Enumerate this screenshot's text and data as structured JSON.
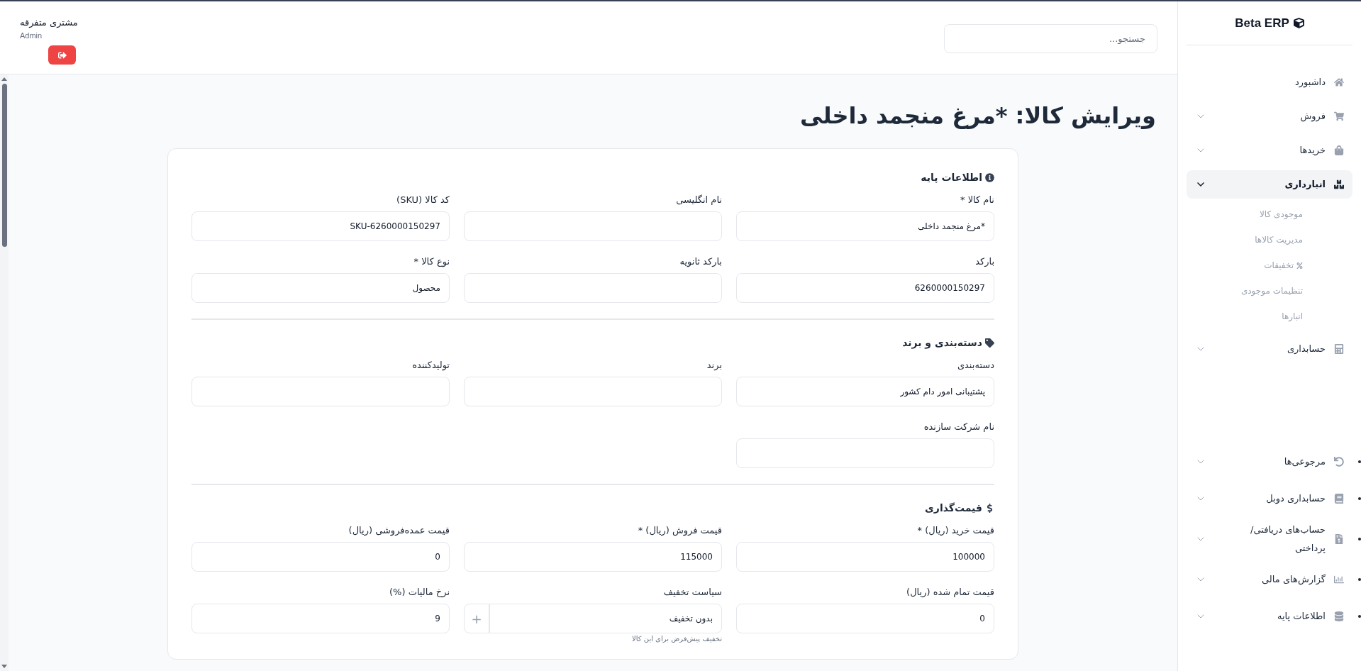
{
  "sidebar": {
    "brand": "Beta ERP",
    "items": [
      {
        "label": "داشبورد",
        "kind": "link",
        "selected": false
      },
      {
        "label": "فروش",
        "kind": "group",
        "selected": false,
        "expanded": false
      },
      {
        "label": "خریدها",
        "kind": "group",
        "selected": false,
        "expanded": false
      },
      {
        "label": "انبارداری",
        "kind": "group",
        "selected": true,
        "expanded": true,
        "children": [
          {
            "label": "موجودی کالا",
            "kind": "plain"
          },
          {
            "label": "مدیریت کالاها",
            "kind": "plain"
          },
          {
            "label": "تخفیفات",
            "kind": "percent"
          },
          {
            "label": "تنظیمات موجودی",
            "kind": "plain"
          },
          {
            "label": "انبارها",
            "kind": "plain"
          }
        ]
      },
      {
        "label": "حسابداری",
        "kind": "group",
        "selected": false,
        "expanded": false
      }
    ],
    "bottom_items": [
      {
        "label": "مرجوعی‌ها",
        "expanded": false
      },
      {
        "label": "حسابداری دوبل",
        "expanded": false
      },
      {
        "label": "حساب‌های دریافتی/ پرداختی",
        "expanded": false
      },
      {
        "label": "گزارش‌های مالی",
        "expanded": false
      },
      {
        "label": "اطلاعات پایه",
        "expanded": false
      }
    ]
  },
  "header": {
    "search": {
      "placeholder": "جستجو..."
    },
    "user": {
      "name": "مشتری متفرقه",
      "role": "Admin"
    }
  },
  "page_title": "ویرایش کالا: *مرغ منجمد داخلی",
  "sections": [
    {
      "title": "اطلاعات پایه",
      "fields": [
        {
          "label": "نام کالا *",
          "value": "*مرغ منجمد داخلی"
        },
        {
          "label": "نام انگلیسی"
        },
        {
          "label": "کد کالا (SKU)",
          "value": "SKU-6260000150297"
        },
        {
          "label": "بارکد",
          "value": "6260000150297"
        },
        {
          "label": "بارکد ثانویه"
        },
        {
          "label": "نوع کالا *",
          "value": "محصول"
        }
      ]
    },
    {
      "title": "دسته‌بندی و برند",
      "fields": [
        {
          "label": "دسته‌بندی",
          "value": "پشتیبانی امور دام کشور"
        },
        {
          "label": "برند"
        },
        {
          "label": "تولیدکننده"
        },
        {
          "label": "نام شرکت سازنده"
        }
      ]
    },
    {
      "title": "قیمت‌گذاری",
      "fields": [
        {
          "label": "قیمت خرید (ریال) *",
          "value": "100000"
        },
        {
          "label": "قیمت فروش (ریال) *",
          "value": "115000"
        },
        {
          "label": "قیمت عمده‌فروشی (ریال)",
          "value": "0"
        },
        {
          "label": "قیمت تمام شده (ریال)",
          "value": "0"
        },
        {
          "label": "سیاست تخفیف",
          "value": "بدون تخفیف",
          "add_button": "+",
          "hint": "تخفیف پیش‌فرض برای این کالا"
        },
        {
          "label": "نرخ مالیات (%)",
          "value": "9"
        }
      ]
    }
  ]
}
